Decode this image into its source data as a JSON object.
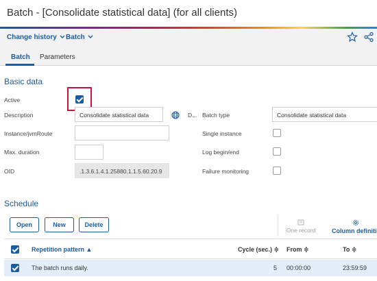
{
  "window": {
    "title": "Batch - [Consolidate statistical data] (for all clients)"
  },
  "toolbar": {
    "change_history": "Change history",
    "batch_menu": "Batch",
    "icons": [
      "star-icon",
      "share-icon"
    ]
  },
  "tabs": [
    {
      "label": "Batch",
      "active": true
    },
    {
      "label": "Parameters",
      "active": false
    }
  ],
  "basic_data": {
    "title": "Basic data",
    "active": {
      "label": "Active",
      "checked": true
    },
    "description": {
      "label": "Description",
      "value": "Consolidate statistical data",
      "trailing": "D..."
    },
    "instance": {
      "label": "Instance/jvmRoute",
      "value": ""
    },
    "max_duration": {
      "label": "Max. duration",
      "value": ""
    },
    "oid": {
      "label": "OID",
      "value": ".1.3.6.1.4.1.25880.1.1.5.60.20.9"
    },
    "batch_type": {
      "label": "Batch type",
      "value": "Consolidate statistical data"
    },
    "single_instance": {
      "label": "Single instance",
      "checked": false
    },
    "log_begin_end": {
      "label": "Log begin/end",
      "checked": false
    },
    "failure_monitoring": {
      "label": "Failure monitoring",
      "checked": false
    }
  },
  "schedule": {
    "title": "Schedule",
    "buttons": {
      "open": "Open",
      "new": "New",
      "delete": "Delete"
    },
    "one_record": "One record",
    "column_definition": "Column definiti",
    "columns": {
      "pattern": "Repetition pattern ▲",
      "cycle": "Cycle (sec.) ≑",
      "from": "From ≑",
      "to": "To ≑"
    },
    "rows": [
      {
        "checked": true,
        "pattern": "The batch runs daily.",
        "cycle": "5",
        "from": "00:00:00",
        "to": "23:59:59"
      }
    ]
  },
  "colors": {
    "accent": "#1d5b9f",
    "highlight": "#c2143c",
    "row_selected": "#e3eefa"
  }
}
